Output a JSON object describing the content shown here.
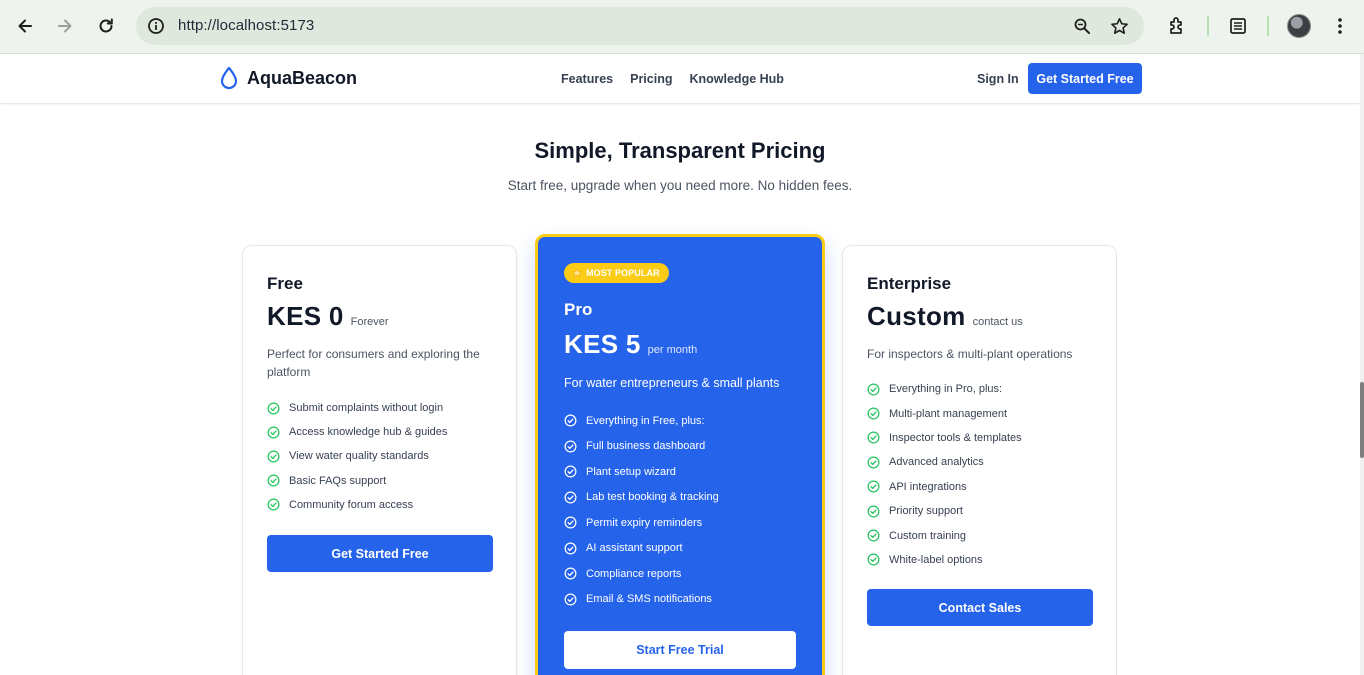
{
  "browser": {
    "url": "http://localhost:5173",
    "back_icon": "arrow-left-icon",
    "forward_icon": "arrow-right-icon",
    "reload_icon": "reload-icon"
  },
  "site": {
    "brand": "AquaBeacon",
    "nav": [
      "Features",
      "Pricing",
      "Knowledge Hub"
    ],
    "sign_in": "Sign In",
    "cta": "Get Started Free"
  },
  "pricing": {
    "title": "Simple, Transparent Pricing",
    "subtitle": "Start free, upgrade when you need more. No hidden fees."
  },
  "plans": {
    "free": {
      "name": "Free",
      "price": "KES 0",
      "period": "Forever",
      "description": "Perfect for consumers and exploring the platform",
      "features": [
        "Submit complaints without login",
        "Access knowledge hub & guides",
        "View water quality standards",
        "Basic FAQs support",
        "Community forum access"
      ],
      "button": "Get Started Free"
    },
    "pro": {
      "badge": "MOST POPULAR",
      "name": "Pro",
      "price": "KES 5",
      "period": "per month",
      "description": "For water entrepreneurs & small plants",
      "features": [
        "Everything in Free, plus:",
        "Full business dashboard",
        "Plant setup wizard",
        "Lab test booking & tracking",
        "Permit expiry reminders",
        "AI assistant support",
        "Compliance reports",
        "Email & SMS notifications"
      ],
      "button": "Start Free Trial"
    },
    "enterprise": {
      "name": "Enterprise",
      "price": "Custom",
      "period": "contact us",
      "description": "For inspectors & multi-plant operations",
      "features": [
        "Everything in Pro, plus:",
        "Multi-plant management",
        "Inspector tools & templates",
        "Advanced analytics",
        "API integrations",
        "Priority support",
        "Custom training",
        "White-label options"
      ],
      "button": "Contact Sales"
    }
  },
  "colors": {
    "primary": "#2563eb",
    "badge": "#facc15",
    "check": "#22c55e"
  }
}
